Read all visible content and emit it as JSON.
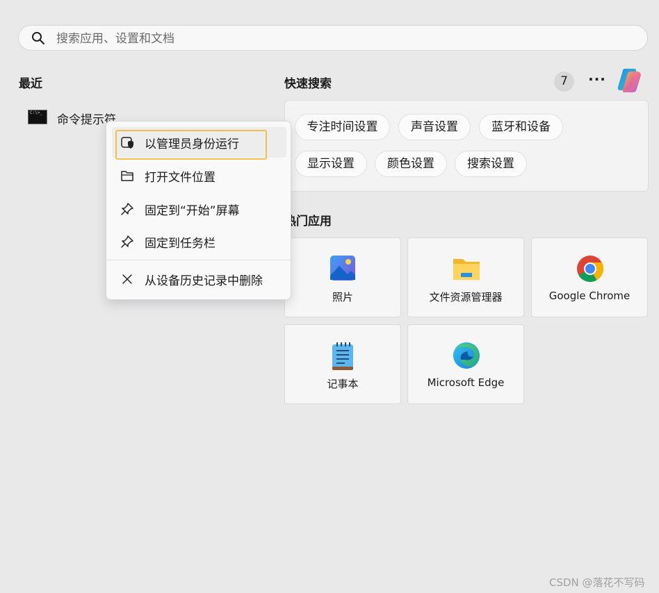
{
  "search": {
    "placeholder": "搜索应用、设置和文档"
  },
  "recent": {
    "title": "最近",
    "items": [
      {
        "label": "命令提示符",
        "icon": "command-prompt-icon"
      }
    ]
  },
  "quick_search": {
    "title": "快速搜索",
    "counter": "7",
    "chips": [
      "专注时间设置",
      "声音设置",
      "蓝牙和设备",
      "显示设置",
      "颜色设置",
      "搜索设置"
    ]
  },
  "hot_apps": {
    "title": "热门应用",
    "apps": [
      {
        "label": "照片",
        "icon": "photos-icon"
      },
      {
        "label": "文件资源管理器",
        "icon": "file-explorer-icon"
      },
      {
        "label": "Google Chrome",
        "icon": "chrome-icon"
      },
      {
        "label": "记事本",
        "icon": "notepad-icon"
      },
      {
        "label": "Microsoft Edge",
        "icon": "edge-icon"
      }
    ]
  },
  "context_menu": {
    "items": [
      {
        "label": "以管理员身份运行",
        "icon": "shield-icon"
      },
      {
        "label": "打开文件位置",
        "icon": "folder-icon"
      },
      {
        "label": "固定到“开始”屏幕",
        "icon": "pin-icon"
      },
      {
        "label": "固定到任务栏",
        "icon": "pin-icon"
      },
      {
        "label": "从设备历史记录中删除",
        "icon": "close-icon"
      }
    ]
  },
  "watermark": "CSDN @落花不写码",
  "colors": {
    "focus_ring": "#f0bf4c",
    "background": "#e9e9ea"
  }
}
